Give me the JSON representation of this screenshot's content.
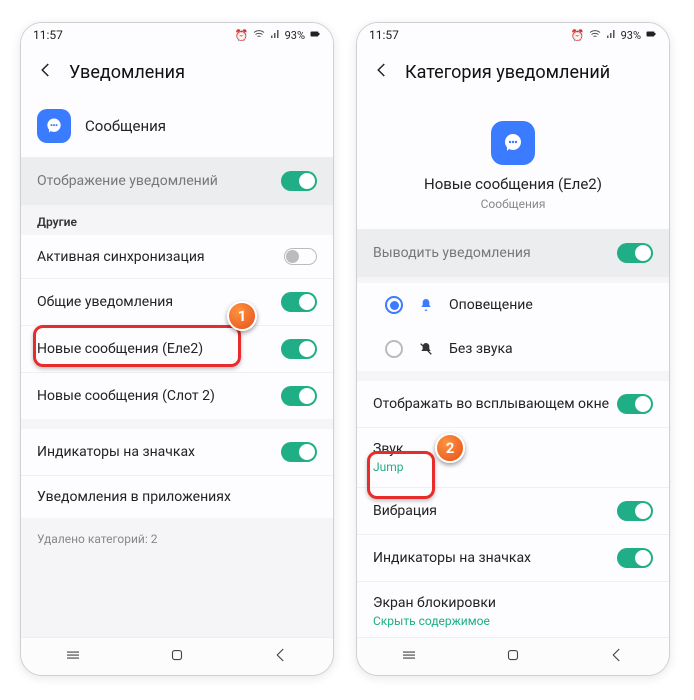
{
  "status": {
    "time": "11:57",
    "battery": "93%"
  },
  "left": {
    "title": "Уведомления",
    "app_label": "Сообщения",
    "show_notifications": "Отображение уведомлений",
    "section_other": "Другие",
    "items": [
      {
        "label": "Активная синхронизация",
        "toggle": "off"
      },
      {
        "label": "Общие уведомления",
        "toggle": "on"
      },
      {
        "label": "Новые сообщения (Еле2)",
        "toggle": "on"
      },
      {
        "label": "Новые сообщения (Слот 2)",
        "toggle": "on"
      }
    ],
    "badges": "Индикаторы на значках",
    "inapp": "Уведомления в приложениях",
    "removed": "Удалено категорий: 2"
  },
  "right": {
    "title": "Категория уведомлений",
    "cat_name": "Новые сообщения (Еле2)",
    "cat_sub": "Сообщения",
    "emit": "Выводить уведомления",
    "opt_alert": "Оповещение",
    "opt_silent": "Без звука",
    "popup": "Отображать во всплывающем окне",
    "sound": "Звук",
    "sound_value": "Jump",
    "vibration": "Вибрация",
    "badges": "Индикаторы на значках",
    "lock": "Экран блокировки",
    "lock_value": "Скрыть содержимое"
  },
  "callouts": {
    "one": "1",
    "two": "2"
  }
}
